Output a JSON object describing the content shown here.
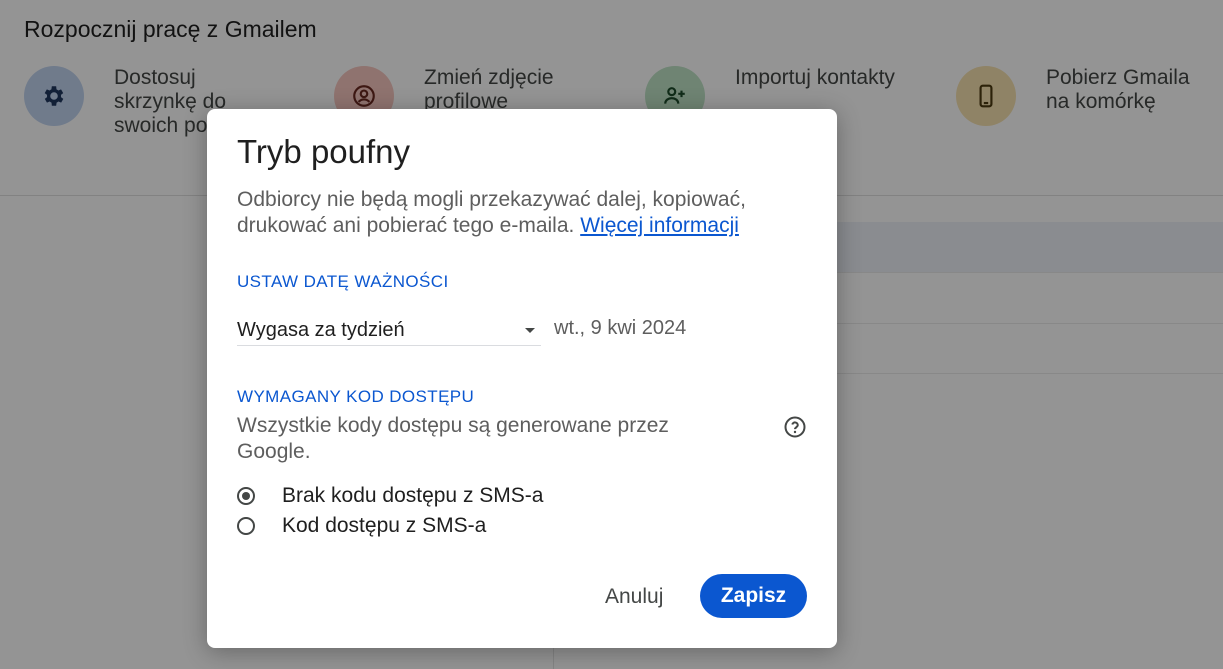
{
  "setup": {
    "title": "Rozpocznij pracę z Gmailem",
    "cards": [
      {
        "icon": "gear-icon",
        "label": "Dostosuj skrzynkę do swoich potrzeb"
      },
      {
        "icon": "account-circle-icon",
        "label": "Zmień zdjęcie profilowe"
      },
      {
        "icon": "add-contacts-icon",
        "label": "Importuj kontakty"
      },
      {
        "icon": "smartphone-icon",
        "label": "Pobierz Gmaila na komórkę"
      }
    ]
  },
  "dialog": {
    "title": "Tryb poufny",
    "description": "Odbiorcy nie będą mogli przekazywać dalej, kopiować, drukować ani pobierać tego e-maila.",
    "learn_more": "Więcej informacji",
    "expiry": {
      "heading": "USTAW DATĘ WAŻNOŚCI",
      "selected": "Wygasa za tydzień",
      "date": "wt., 9 kwi 2024"
    },
    "passcode": {
      "heading": "WYMAGANY KOD DOSTĘPU",
      "description": "Wszystkie kody dostępu są generowane przez Google.",
      "options": [
        {
          "label": "Brak kodu dostępu z SMS-a",
          "checked": true
        },
        {
          "label": "Kod dostępu z SMS-a",
          "checked": false
        }
      ]
    },
    "cancel_label": "Anuluj",
    "save_label": "Zapisz"
  },
  "colors": {
    "accent": "#0b57d0",
    "scrim": "rgba(0,0,0,0.42)"
  }
}
